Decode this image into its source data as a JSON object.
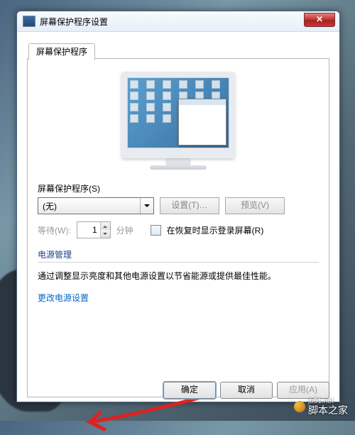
{
  "window": {
    "title": "屏幕保护程序设置",
    "close_symbol": "✕"
  },
  "tab": {
    "label": "屏幕保护程序"
  },
  "screensaver": {
    "section_label": "屏幕保护程序(S)",
    "selected": "(无)",
    "settings_btn": "设置(T)…",
    "preview_btn": "预览(V)"
  },
  "wait": {
    "label": "等待(W):",
    "value": "1",
    "unit": "分钟",
    "resume_checkbox_label": "在恢复时显示登录屏幕(R)"
  },
  "power": {
    "group_title": "电源管理",
    "description": "通过调整显示亮度和其他电源设置以节省能源或提供最佳性能。",
    "link": "更改电源设置"
  },
  "footer": {
    "ok": "确定",
    "cancel": "取消",
    "apply": "应用(A)"
  },
  "watermark": {
    "text": "脚本之家",
    "url": "jb51.net"
  }
}
